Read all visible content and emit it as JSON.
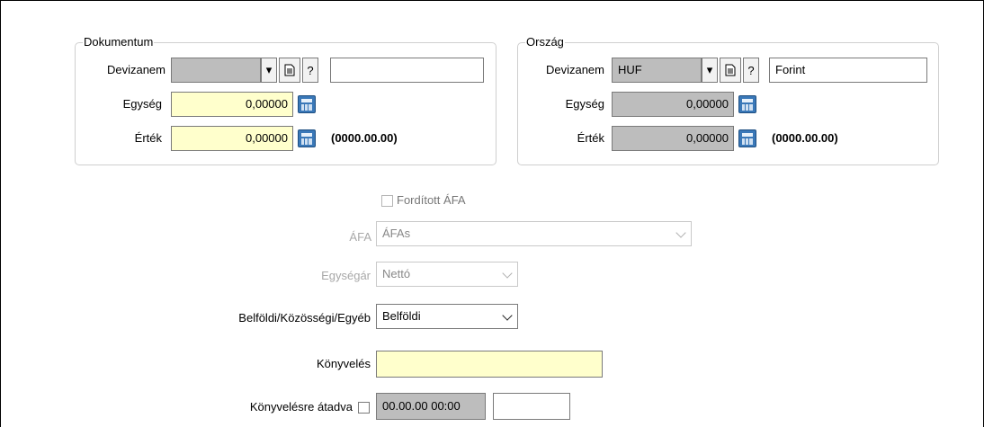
{
  "dokumentum": {
    "legend": "Dokumentum",
    "devizanem_label": "Devizanem",
    "devizanem_value": "",
    "devizanem_name": "",
    "egyseg_label": "Egység",
    "egyseg_value": "0,00000",
    "ertek_label": "Érték",
    "ertek_value": "0,00000",
    "date_text": "(0000.00.00)"
  },
  "orszag": {
    "legend": "Ország",
    "devizanem_label": "Devizanem",
    "devizanem_value": "HUF",
    "devizanem_name": "Forint",
    "egyseg_label": "Egység",
    "egyseg_value": "0,00000",
    "ertek_label": "Érték",
    "ertek_value": "0,00000",
    "date_text": "(0000.00.00)"
  },
  "buttons": {
    "dropdown": "▾",
    "help": "?"
  },
  "forditott_afa": {
    "label": "Fordított ÁFA",
    "checked": false
  },
  "afa": {
    "label": "ÁFA",
    "value": "ÁFAs"
  },
  "egysegar": {
    "label": "Egységár",
    "value": "Nettó"
  },
  "belfoldi": {
    "label": "Belföldi/Közösségi/Egyéb",
    "value": "Belföldi"
  },
  "konyveles": {
    "label": "Könyvelés",
    "value": ""
  },
  "konyvelesre_atadva": {
    "label": "Könyvelésre átadva",
    "checked": false,
    "datetime": "00.00.00 00:00",
    "extra": ""
  },
  "icons": {
    "calculator": "calculator-icon",
    "document": "document-icon"
  }
}
